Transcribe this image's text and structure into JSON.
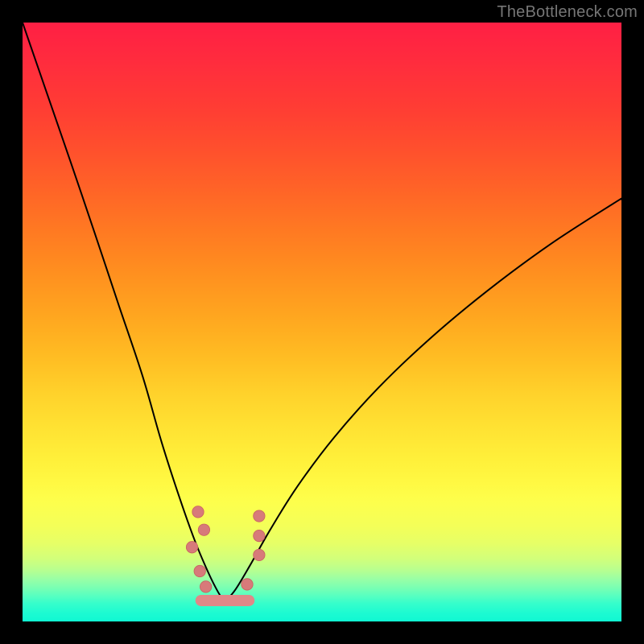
{
  "wm": "TheBottleneck.com",
  "frame_color": "#000000",
  "gradient_stops": [
    {
      "y": 0.0,
      "c": "#ff1f44"
    },
    {
      "y": 0.07,
      "c": "#ff2d3d"
    },
    {
      "y": 0.14,
      "c": "#ff3c34"
    },
    {
      "y": 0.21,
      "c": "#ff4f2d"
    },
    {
      "y": 0.28,
      "c": "#ff6427"
    },
    {
      "y": 0.35,
      "c": "#ff7a22"
    },
    {
      "y": 0.42,
      "c": "#ff901f"
    },
    {
      "y": 0.49,
      "c": "#ffa61f"
    },
    {
      "y": 0.56,
      "c": "#ffbd23"
    },
    {
      "y": 0.62,
      "c": "#ffd22b"
    },
    {
      "y": 0.68,
      "c": "#ffe333"
    },
    {
      "y": 0.73,
      "c": "#fff03a"
    },
    {
      "y": 0.77,
      "c": "#fff943"
    },
    {
      "y": 0.8,
      "c": "#fdff4c"
    },
    {
      "y": 0.84,
      "c": "#f4ff58"
    },
    {
      "y": 0.87,
      "c": "#e6ff67"
    },
    {
      "y": 0.895,
      "c": "#d2ff7a"
    },
    {
      "y": 0.915,
      "c": "#b6ff91"
    },
    {
      "y": 0.93,
      "c": "#97ffa6"
    },
    {
      "y": 0.945,
      "c": "#76ffb4"
    },
    {
      "y": 0.958,
      "c": "#55ffc1"
    },
    {
      "y": 0.97,
      "c": "#36fecb"
    },
    {
      "y": 0.985,
      "c": "#1efbd1"
    },
    {
      "y": 1.0,
      "c": "#10f8d3"
    }
  ],
  "curve_style": {
    "stroke": "#000000",
    "width": 2
  },
  "marker_style": {
    "fill": "#d77a7a",
    "stroke": "#c86060",
    "r": 7.2
  },
  "bottom_cap": {
    "fill": "#e08888",
    "y": 0.965,
    "x0": 0.298,
    "x1": 0.378,
    "r": 7
  },
  "markers": [
    {
      "x": 0.293,
      "y": 0.817
    },
    {
      "x": 0.303,
      "y": 0.847
    },
    {
      "x": 0.283,
      "y": 0.876
    },
    {
      "x": 0.296,
      "y": 0.916
    },
    {
      "x": 0.306,
      "y": 0.942
    },
    {
      "x": 0.395,
      "y": 0.824
    },
    {
      "x": 0.395,
      "y": 0.857
    },
    {
      "x": 0.395,
      "y": 0.889
    },
    {
      "x": 0.375,
      "y": 0.938
    }
  ],
  "chart_data": {
    "type": "line",
    "title": "",
    "xlabel": "",
    "ylabel": "",
    "xlim": [
      0,
      1
    ],
    "ylim": [
      0,
      1
    ],
    "series": [
      {
        "name": "left-branch",
        "x": [
          0.0,
          0.04,
          0.08,
          0.12,
          0.16,
          0.2,
          0.232,
          0.262,
          0.288,
          0.31,
          0.326,
          0.335,
          0.34
        ],
        "y": [
          0.0,
          0.116,
          0.232,
          0.35,
          0.47,
          0.589,
          0.7,
          0.793,
          0.866,
          0.918,
          0.95,
          0.963,
          0.965
        ]
      },
      {
        "name": "right-branch",
        "x": [
          0.34,
          0.356,
          0.38,
          0.414,
          0.46,
          0.52,
          0.594,
          0.68,
          0.776,
          0.88,
          0.99,
          1.0
        ],
        "y": [
          0.965,
          0.946,
          0.906,
          0.846,
          0.773,
          0.693,
          0.61,
          0.528,
          0.448,
          0.371,
          0.3,
          0.295
        ]
      }
    ],
    "scatter": {
      "name": "markers",
      "x": [
        0.293,
        0.303,
        0.283,
        0.296,
        0.306,
        0.395,
        0.395,
        0.395,
        0.375
      ],
      "y": [
        0.817,
        0.847,
        0.876,
        0.916,
        0.942,
        0.824,
        0.857,
        0.889,
        0.938
      ]
    }
  }
}
